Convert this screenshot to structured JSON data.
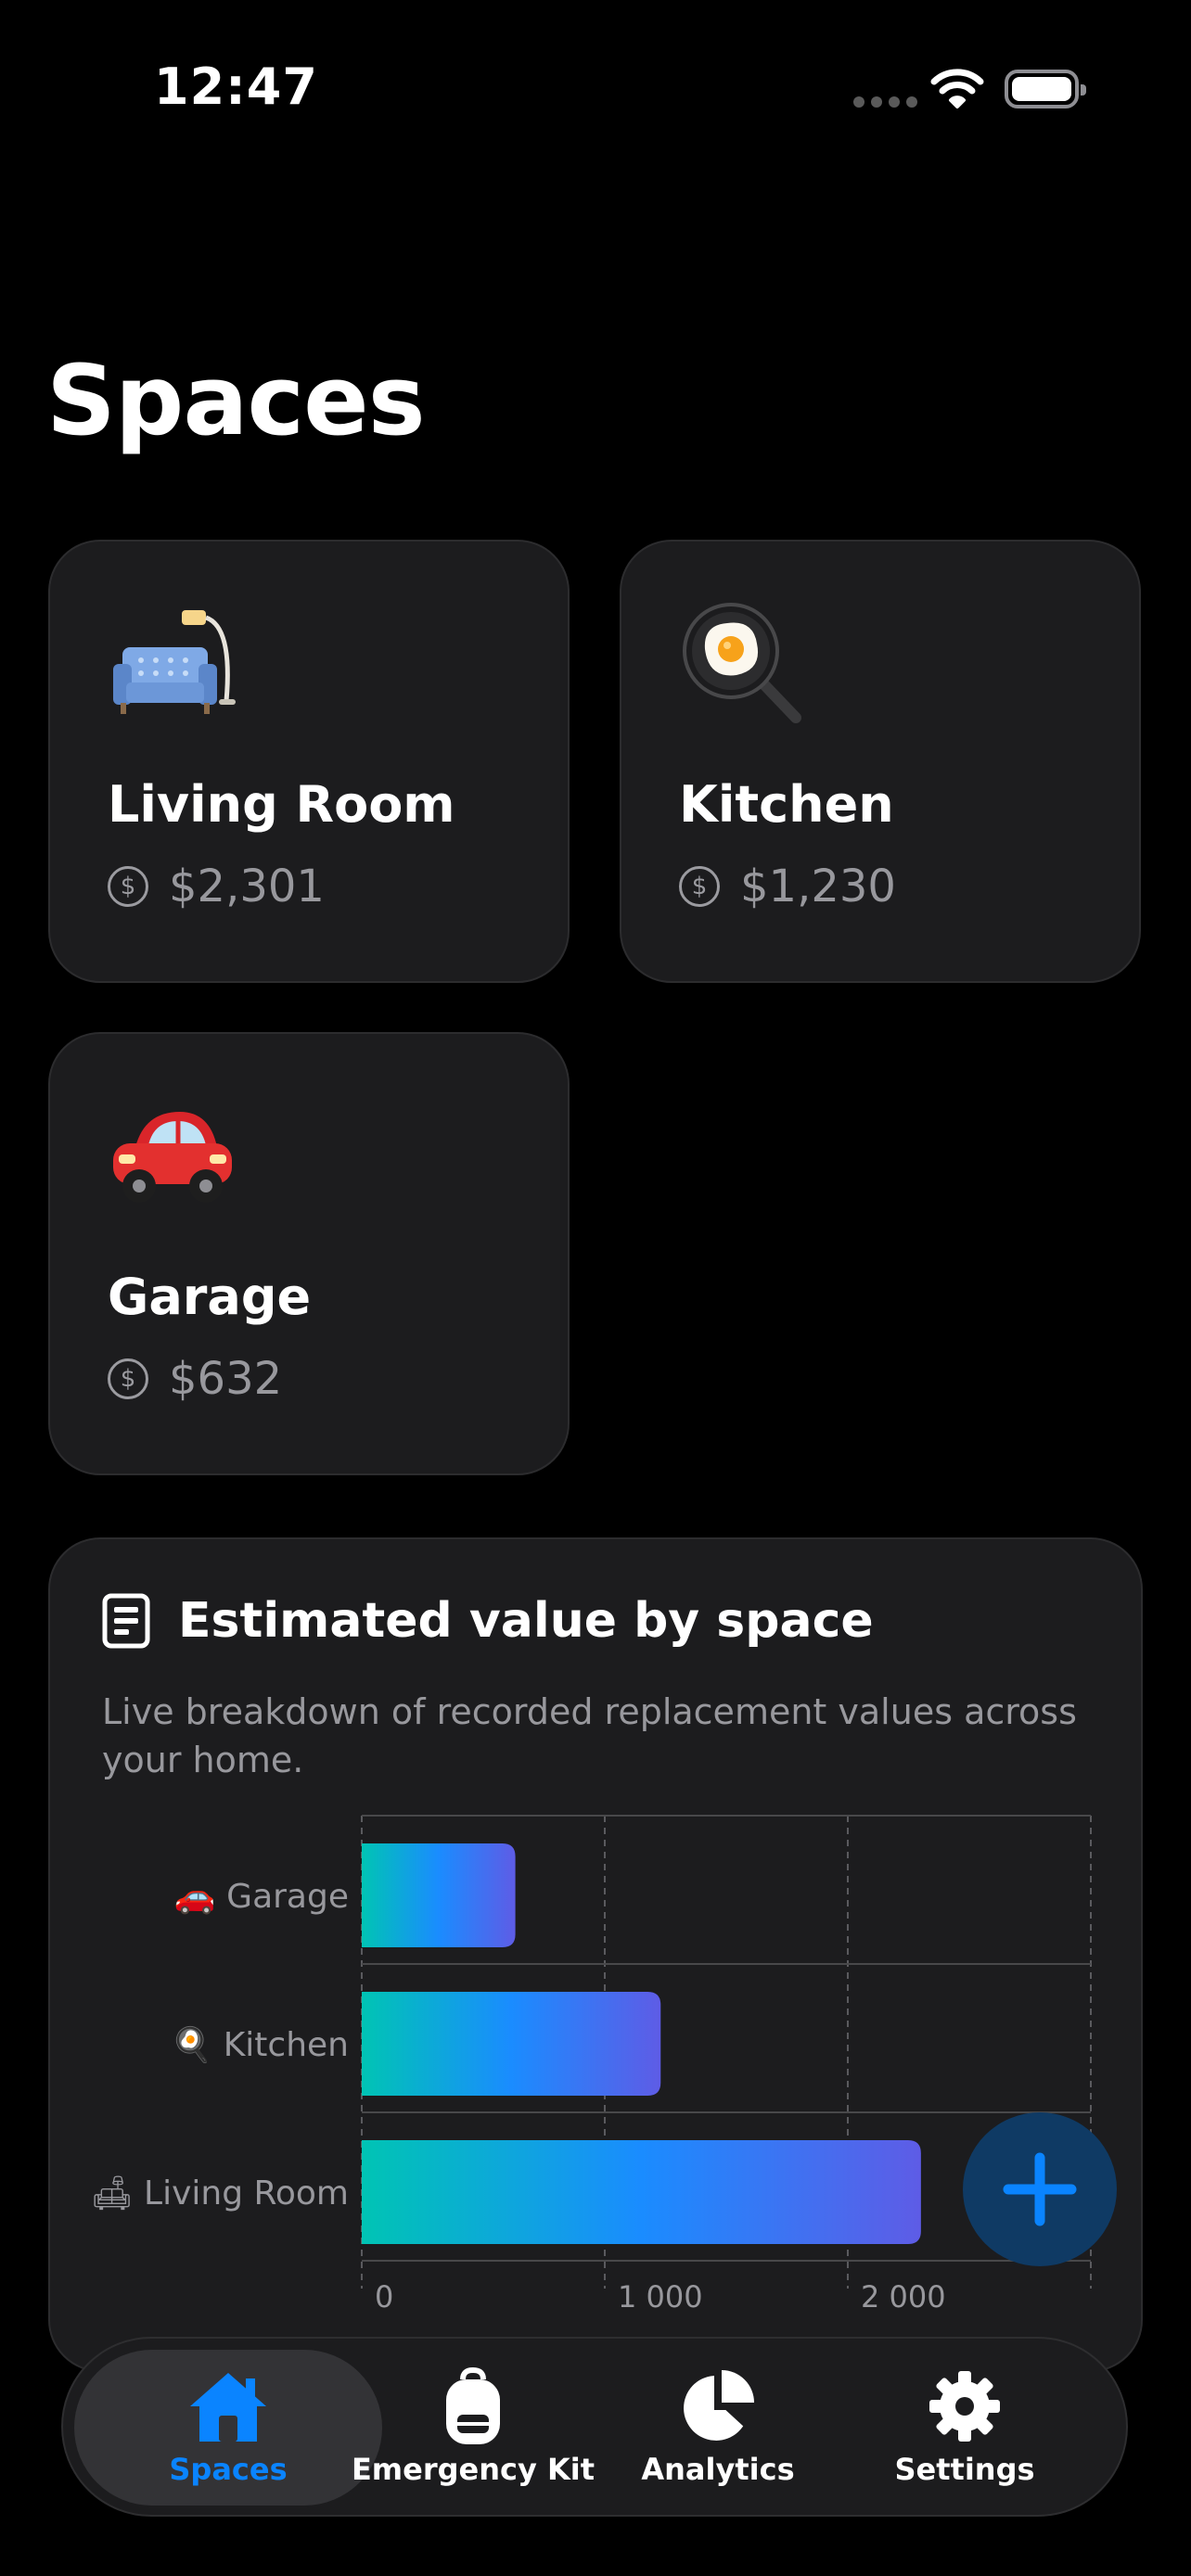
{
  "status_bar": {
    "time": "12:47"
  },
  "page": {
    "title": "Spaces"
  },
  "spaces": [
    {
      "name": "Living Room",
      "value": "$2,301",
      "icon": "couch-and-lamp-emoji"
    },
    {
      "name": "Kitchen",
      "value": "$1,230",
      "icon": "frying-pan-egg-emoji"
    },
    {
      "name": "Garage",
      "value": "$632",
      "icon": "red-car-emoji"
    }
  ],
  "value_icon": "dollar-circle-icon",
  "chart_card": {
    "icon": "document-icon",
    "title": "Estimated value by space",
    "description": "Live breakdown of recorded replacement values across your home."
  },
  "chart_data": {
    "type": "bar",
    "orientation": "horizontal",
    "categories": [
      "Garage",
      "Kitchen",
      "Living Room"
    ],
    "values": [
      632,
      1230,
      2301
    ],
    "xlim": [
      0,
      3000
    ],
    "x_ticks": [
      0,
      1000,
      2000
    ],
    "x_tick_labels": [
      "0",
      "1 000",
      "2 000"
    ],
    "grid": true,
    "bar_gradient": [
      "#00c4b4",
      "#1a8cff",
      "#5e5ce6"
    ]
  },
  "fab": {
    "icon": "plus-icon",
    "color": "#0a84ff"
  },
  "tab_bar": {
    "items": [
      {
        "label": "Spaces",
        "icon": "house-icon",
        "active": true
      },
      {
        "label": "Emergency Kit",
        "icon": "backpack-icon",
        "active": false
      },
      {
        "label": "Analytics",
        "icon": "pie-chart-icon",
        "active": false
      },
      {
        "label": "Settings",
        "icon": "gear-icon",
        "active": false
      }
    ],
    "active_color": "#0a84ff"
  }
}
